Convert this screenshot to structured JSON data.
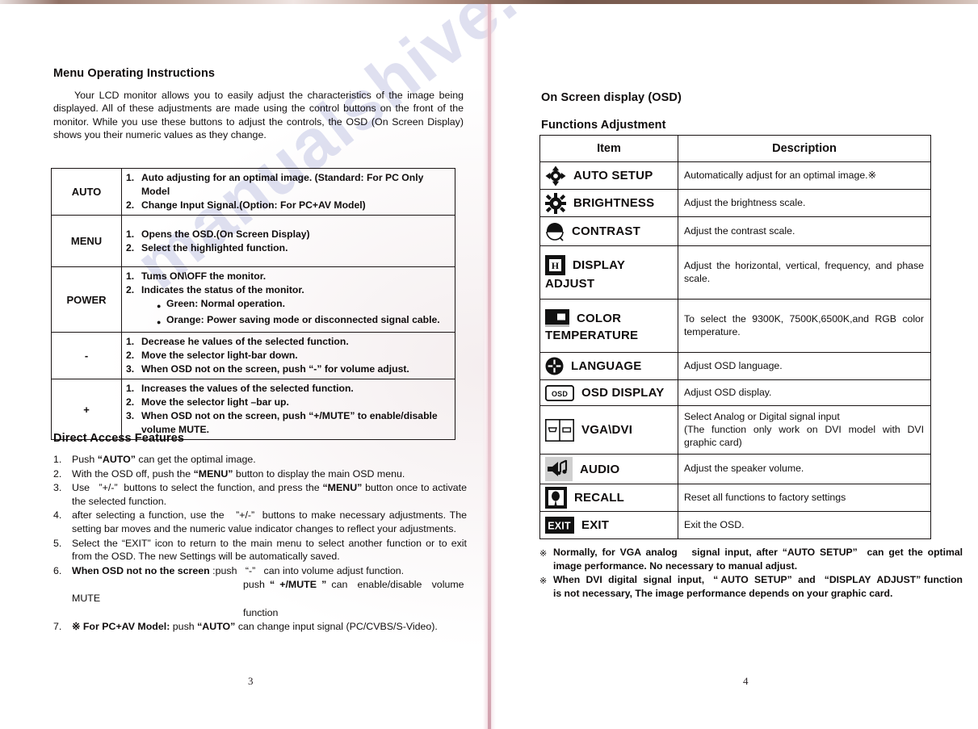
{
  "document": {
    "watermark": "manualshive.com"
  },
  "left_page": {
    "page_number": "3",
    "heading": "Menu Operating Instructions",
    "intro": "Your LCD monitor allows you to easily adjust the characteristics of the image being displayed. All of these adjustments are made using the control buttons on the front of the monitor. While you use these buttons to adjust the controls, the OSD (On Screen Display) shows you their numeric values as they change.",
    "button_table": {
      "rows": [
        {
          "key": "AUTO",
          "lines": [
            {
              "num": "1.",
              "text": "Auto adjusting for an optimal image. (Standard: For PC Only Model"
            },
            {
              "num": "2.",
              "text": "Change Input Signal.(Option: For PC+AV Model)"
            }
          ]
        },
        {
          "key": "MENU",
          "lines": [
            {
              "num": "1.",
              "text": "Opens the OSD.(On Screen Display)"
            },
            {
              "num": "2.",
              "text": "Select the highlighted function."
            }
          ]
        },
        {
          "key": "POWER",
          "lines": [
            {
              "num": "1.",
              "text": "Tums ON\\OFF the monitor."
            },
            {
              "num": "2.",
              "text": "Indicates the status of the monitor."
            },
            {
              "num": "●",
              "text": "Green: Normal operation.",
              "bullet": true
            },
            {
              "num": "●",
              "text": "Orange: Power saving mode or disconnected signal cable.",
              "bullet": true
            }
          ]
        },
        {
          "key": "-",
          "lines": [
            {
              "num": "1.",
              "text": "Decrease he values of the selected function."
            },
            {
              "num": "2.",
              "text": "Move the selector light-bar down."
            },
            {
              "num": "3.",
              "text": "When OSD not on the screen, push   “-”   for volume adjust."
            }
          ]
        },
        {
          "key": "+",
          "lines": [
            {
              "num": "1.",
              "text": "Increases the values of the selected function."
            },
            {
              "num": "2.",
              "text": "Move the selector light –bar up."
            },
            {
              "num": "3.",
              "text": "When OSD not on the screen, push   “+/MUTE” to enable/disable volume   MUTE."
            }
          ]
        }
      ]
    },
    "direct_access": {
      "heading": "Direct Access Features",
      "items": [
        {
          "num": "1.",
          "html": "Push <b>“AUTO”</b> can get the optimal image."
        },
        {
          "num": "2.",
          "html": "With the OSD off, push the <b>“MENU”</b> button to display the main OSD menu."
        },
        {
          "num": "3.",
          "html": "Use&nbsp; &nbsp;”+/-”&nbsp; buttons to select the function, and press the <b>“MENU”</b> button once to activate the selected function."
        },
        {
          "num": "4.",
          "html": "after selecting a function, use the&nbsp; &nbsp;”+/-”&nbsp; buttons to make necessary adjustments. The setting bar moves and the numeric value indicator changes to reflect your adjustments."
        },
        {
          "num": "5.",
          "html": "Select the “EXIT” icon to return to the main menu to select another function or to exit from the OSD. The new Settings will be automatically saved."
        },
        {
          "num": "6.",
          "html": "<b>When OSD not no the screen</b> :push&nbsp; &nbsp;“-”&nbsp; &nbsp;can into volume adjust function."
        },
        {
          "num": "",
          "html": "<span style=\"display:inline-block;width:212px\"></span>push <b>“ +/MUTE ”</b> can&nbsp; enable/disable&nbsp; volume&nbsp; MUTE"
        },
        {
          "num": "",
          "html": "<span style=\"display:inline-block;width:212px\"></span>function"
        },
        {
          "num": "7.",
          "html": "<b>※ For PC+AV Model:</b> push <b>“AUTO”</b> can change input signal (PC/CVBS/S-Video)."
        }
      ]
    }
  },
  "right_page": {
    "page_number": "4",
    "heading": "On Screen display (OSD)",
    "subheading": "Functions Adjustment",
    "table": {
      "headers": [
        "Item",
        "Description"
      ],
      "rows": [
        {
          "icon": "four-arrows-icon",
          "label": "AUTO SETUP",
          "label2": "",
          "description": "Automatically adjust for an optimal image.※",
          "justify": false
        },
        {
          "icon": "sun-brightness-icon",
          "label": "BRIGHTNESS",
          "label2": "",
          "description": "Adjust the brightness scale.",
          "justify": false
        },
        {
          "icon": "contrast-circle-icon",
          "label": "CONTRAST",
          "label2": "",
          "description": "Adjust the contrast scale.",
          "justify": false
        },
        {
          "icon": "h-square-icon",
          "label": "DISPLAY",
          "label2": "ADJUST",
          "description": "Adjust the horizontal, vertical, frequency, and phase scale.",
          "justify": true
        },
        {
          "icon": "color-bar-icon",
          "label": "COLOR",
          "label2": "TEMPERATURE",
          "description": "To select the 9300K, 7500K,6500K,and RGB color temperature.",
          "justify": true
        },
        {
          "icon": "globe-cross-icon",
          "label": "LANGUAGE",
          "label2": "",
          "description": "Adjust OSD language.",
          "justify": false
        },
        {
          "icon": "osd-box-icon",
          "label": "OSD DISPLAY",
          "label2": "",
          "description": "Adjust OSD display.",
          "justify": false
        },
        {
          "icon": "vga-dvi-connector-icon",
          "label": "VGA\\DVI",
          "label2": "",
          "description": "Select Analog or Digital signal input\n(The function only work on DVI model with DVI graphic card)",
          "justify": true
        },
        {
          "icon": "speaker-notes-icon",
          "label": "AUDIO",
          "label2": "",
          "description": "Adjust the speaker volume.",
          "justify": false
        },
        {
          "icon": "recall-icon",
          "label": "RECALL",
          "label2": "",
          "description": "Reset all functions to factory settings",
          "justify": false
        },
        {
          "icon": "exit-box-icon",
          "label": "EXIT",
          "label2": "",
          "description": "Exit the OSD.",
          "justify": false
        }
      ]
    },
    "notes": [
      {
        "mark": "※",
        "html": "Normally, for VGA analog&nbsp; &nbsp;signal input, after “AUTO SETUP”&nbsp; can get the optimal image performance. No necessary to manual adjust."
      },
      {
        "mark": "※",
        "html": "When&nbsp; DVI&nbsp; digital&nbsp; signal&nbsp; input,&nbsp; &nbsp;“ AUTO&nbsp; SETUP”&nbsp; and&nbsp; &nbsp;“DISPLAY&nbsp; ADJUST” function is not necessary, The image performance depends on your graphic card."
      }
    ]
  }
}
